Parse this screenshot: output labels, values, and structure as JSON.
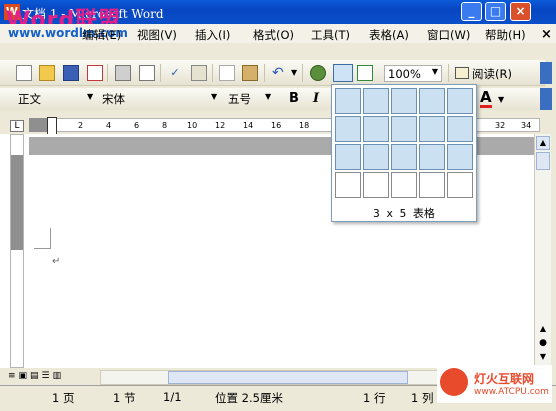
{
  "window": {
    "title": "文档 1 - Microsoft Word",
    "brand_logo": "Word联盟",
    "brand_url": "www.wordlm.com",
    "close_doc": "×"
  },
  "menu": [
    "文件(F)",
    "编辑(E)",
    "视图(V)",
    "插入(I)",
    "格式(O)",
    "工具(T)",
    "表格(A)",
    "窗口(W)",
    "帮助(H)"
  ],
  "toolbar": {
    "zoom": "100%",
    "read_label": "阅读(R)"
  },
  "format_bar": {
    "style": "正文",
    "font": "宋体",
    "size": "五号",
    "bold": "B",
    "italic": "I",
    "font_color": "A"
  },
  "ruler": {
    "ticks": [
      "2",
      "4",
      "6",
      "8",
      "10",
      "12",
      "14",
      "16",
      "18",
      "32",
      "34"
    ]
  },
  "table_picker": {
    "rows": 4,
    "cols": 5,
    "selected_rows": 3,
    "selected_cols": 5,
    "label": "3 x 5 表格"
  },
  "status": {
    "page": "1 页",
    "section": "1 节",
    "pages": "1/1",
    "position": "位置 2.5厘米",
    "line": "1 行",
    "col": "1 列"
  },
  "watermark": {
    "name": "灯火互联网",
    "url": "www.ATCPU.com"
  }
}
